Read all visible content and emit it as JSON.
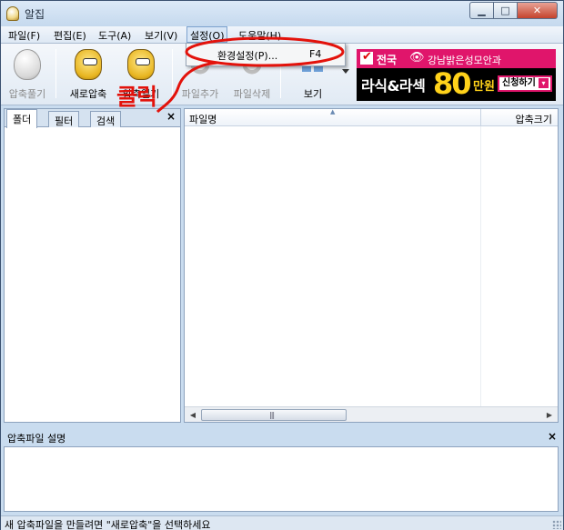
{
  "window": {
    "title": "알집",
    "min_icon": "minimize-icon",
    "max_icon": "maximize-icon",
    "close_icon": "close-icon",
    "min_glyph": "▁",
    "max_glyph": "□",
    "close_glyph": "✕"
  },
  "menu": {
    "file": "파일(F)",
    "edit": "편집(E)",
    "tools": "도구(A)",
    "view": "보기(V)",
    "settings": "설정(O)",
    "help": "도움말(H)"
  },
  "dropdown": {
    "item_label": "환경설정(P)...",
    "item_shortcut": "F4"
  },
  "toolbar": {
    "extract": "압축풀기",
    "new_archive": "새로압축",
    "open_archive": "압축열기",
    "add_file": "파일추가",
    "delete_file": "파일삭제",
    "view": "보기"
  },
  "ad": {
    "region": "전국",
    "eye_glyph": "👁",
    "clinic": "강남밝은성모안과",
    "main": "라식&라섹",
    "price": "80",
    "won": "만원",
    "button": "신청하기",
    "arrow": "▾",
    "colors": {
      "bg": "#000000",
      "brand": "#e0156b",
      "price": "#ffd21a"
    }
  },
  "left_pane": {
    "tabs": [
      "폴더",
      "필터",
      "검색"
    ],
    "close_glyph": "×"
  },
  "file_list": {
    "columns": [
      "파일명",
      "압축크기"
    ],
    "sort_glyph": "▲",
    "scroll_left": "◀",
    "scroll_right": "▶",
    "scroll_grip": "|||"
  },
  "description": {
    "title": "압축파일 설명",
    "close_glyph": "×"
  },
  "status": {
    "text": "새 압축파일을 만들려면 \"새로압축\"을 선택하세요"
  },
  "annotation": {
    "text": "클릭",
    "color": "#e3120b"
  }
}
